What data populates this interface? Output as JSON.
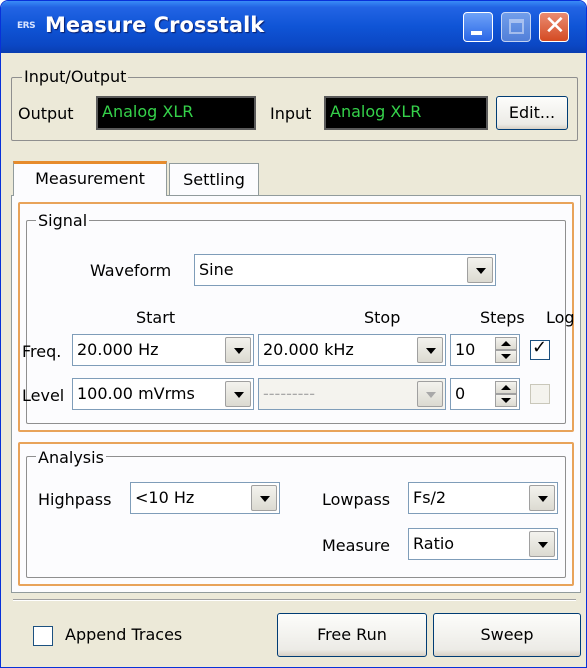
{
  "window": {
    "title": "Measure Crosstalk",
    "app_icon_text": "ERS"
  },
  "io": {
    "group_label": "Input/Output",
    "output_label": "Output",
    "output_value": "Analog XLR",
    "input_label": "Input",
    "input_value": "Analog XLR",
    "edit_button": "Edit..."
  },
  "tabs": [
    {
      "label": "Measurement",
      "active": true
    },
    {
      "label": "Settling",
      "active": false
    }
  ],
  "signal": {
    "group_label": "Signal",
    "waveform_label": "Waveform",
    "waveform_value": "Sine",
    "col_start": "Start",
    "col_stop": "Stop",
    "col_steps": "Steps",
    "col_log": "Log",
    "freq_label": "Freq.",
    "freq_start": "20.000 Hz",
    "freq_stop": "20.000 kHz",
    "freq_steps": "10",
    "freq_log_checked": true,
    "level_label": "Level",
    "level_start": "100.00 mVrms",
    "level_stop": "---------",
    "level_steps": "0",
    "level_log_checked": false
  },
  "analysis": {
    "group_label": "Analysis",
    "highpass_label": "Highpass",
    "highpass_value": "<10 Hz",
    "lowpass_label": "Lowpass",
    "lowpass_value": "Fs/2",
    "measure_label": "Measure",
    "measure_value": "Ratio"
  },
  "footer": {
    "append_traces_label": "Append Traces",
    "append_traces_checked": false,
    "free_run_button": "Free Run",
    "sweep_button": "Sweep"
  },
  "colors": {
    "accent_orange": "#e8a35a",
    "lcd_text": "#35d24a",
    "titlebar_blue": "#0f54d6"
  }
}
